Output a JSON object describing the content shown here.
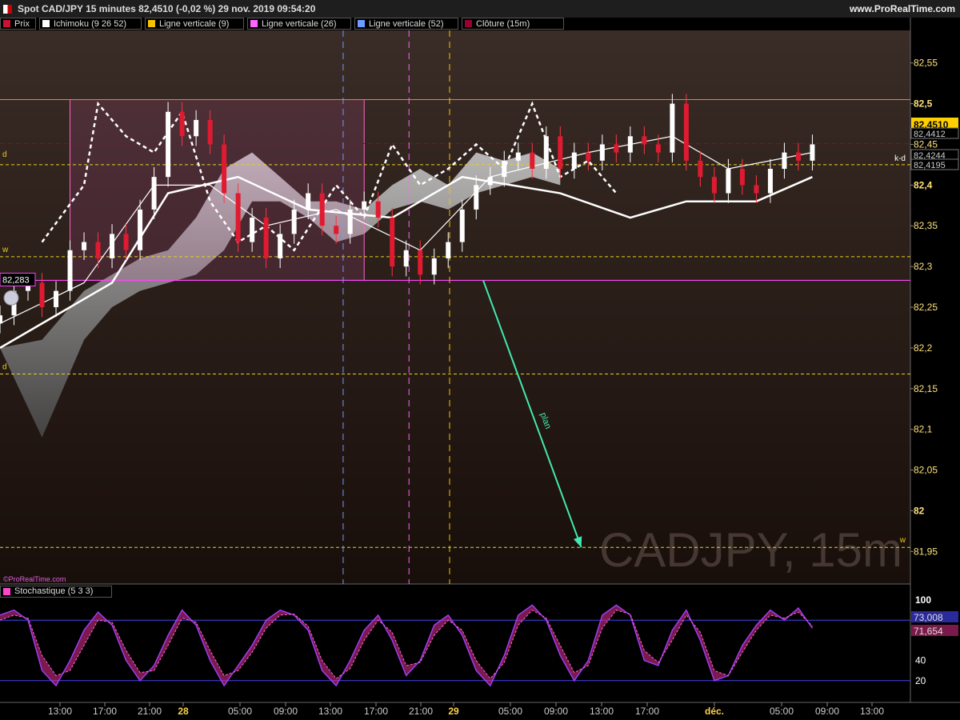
{
  "header": {
    "title": "Spot CAD/JPY 15 minutes 82,4510 (-0,02 %) 29 nov. 2019 09:54:20",
    "site": "www.ProRealTime.com"
  },
  "legend": [
    {
      "label": "Prix",
      "color": "#cc1133",
      "icon": "price-swatch"
    },
    {
      "label": "Ichimoku (9 26 52)",
      "color": "#ffffff",
      "icon": "ichimoku-swatch"
    },
    {
      "label": "Ligne verticale (9)",
      "color": "#f5c400",
      "icon": "vertical-line-swatch"
    },
    {
      "label": "Ligne verticale (26)",
      "color": "#ff66ff",
      "icon": "vertical-line-swatch"
    },
    {
      "label": "Ligne verticale (52)",
      "color": "#6f9cff",
      "icon": "vertical-line-swatch"
    },
    {
      "label": "Clôture (15m)",
      "color": "#990033",
      "icon": "close-swatch"
    }
  ],
  "stoch_legend": {
    "label": "Stochastique (5 3 3)",
    "color": "#ff44cc"
  },
  "copyright": "©ProRealTime.com",
  "watermark": "CADJPY, 15m",
  "current_price_label": "82,4510",
  "left_price_label": "82,283",
  "arrow_label": "plan",
  "level_markers": {
    "d_upper": "d",
    "w_upper": "w",
    "d_lower": "d",
    "w_lower": "w",
    "kd": "k-d"
  },
  "right_value_labels": [
    "82,4510",
    "82,4412",
    "82,4244",
    "82,4195"
  ],
  "stoch_value_labels": [
    "73,008",
    "71,654"
  ],
  "colors": {
    "background": "#000000",
    "price_panel_top": "#3a2c26",
    "price_panel_bottom": "#180e0a",
    "box_border": "#ff66cc",
    "arrow": "#44e8b0",
    "level_line": "#e8d020",
    "resistance": "#ff7733"
  },
  "chart_data": [
    {
      "type": "line",
      "title": "Spot CAD/JPY 15 minutes",
      "ylim": [
        81.91,
        82.59
      ],
      "y_ticks": [
        "82,55",
        "82,5",
        "82,45",
        "82,4",
        "82,35",
        "82,3",
        "82,25",
        "82,2",
        "82,15",
        "82,1",
        "82,05",
        "82",
        "81,95"
      ],
      "y_tick_values": [
        82.55,
        82.5,
        82.45,
        82.4,
        82.35,
        82.3,
        82.25,
        82.2,
        82.15,
        82.1,
        82.05,
        82.0,
        81.95
      ],
      "x_ticks": [
        "13:00",
        "17:00",
        "21:00",
        "28",
        "05:00",
        "09:00",
        "13:00",
        "17:00",
        "21:00",
        "29",
        "05:00",
        "09:00",
        "13:00",
        "17:00",
        "déc.",
        "05:00",
        "09:00",
        "13:00"
      ],
      "horizontal_levels": [
        {
          "name": "d upper",
          "value": 82.425
        },
        {
          "name": "w upper",
          "value": 82.312
        },
        {
          "name": "d lower",
          "value": 82.168
        },
        {
          "name": "w lower",
          "value": 81.955
        },
        {
          "name": "resistance",
          "value": 82.505
        },
        {
          "name": "support",
          "value": 82.283
        },
        {
          "name": "last close",
          "value": 82.451
        }
      ],
      "price_series": [
        {
          "t": 0,
          "v": 82.24
        },
        {
          "t": 1,
          "v": 82.27
        },
        {
          "t": 2,
          "v": 82.28
        },
        {
          "t": 3,
          "v": 82.25
        },
        {
          "t": 4,
          "v": 82.27
        },
        {
          "t": 5,
          "v": 82.32
        },
        {
          "t": 6,
          "v": 82.33
        },
        {
          "t": 7,
          "v": 82.31
        },
        {
          "t": 8,
          "v": 82.34
        },
        {
          "t": 9,
          "v": 82.32
        },
        {
          "t": 10,
          "v": 82.37
        },
        {
          "t": 11,
          "v": 82.41
        },
        {
          "t": 12,
          "v": 82.49
        },
        {
          "t": 13,
          "v": 82.46
        },
        {
          "t": 14,
          "v": 82.48
        },
        {
          "t": 15,
          "v": 82.45
        },
        {
          "t": 16,
          "v": 82.39
        },
        {
          "t": 17,
          "v": 82.33
        },
        {
          "t": 18,
          "v": 82.36
        },
        {
          "t": 19,
          "v": 82.31
        },
        {
          "t": 20,
          "v": 82.34
        },
        {
          "t": 21,
          "v": 82.37
        },
        {
          "t": 22,
          "v": 82.39
        },
        {
          "t": 23,
          "v": 82.35
        },
        {
          "t": 24,
          "v": 82.34
        },
        {
          "t": 25,
          "v": 82.37
        },
        {
          "t": 26,
          "v": 82.38
        },
        {
          "t": 27,
          "v": 82.36
        },
        {
          "t": 28,
          "v": 82.3
        },
        {
          "t": 29,
          "v": 82.32
        },
        {
          "t": 30,
          "v": 82.29
        },
        {
          "t": 31,
          "v": 82.31
        },
        {
          "t": 32,
          "v": 82.33
        },
        {
          "t": 33,
          "v": 82.37
        },
        {
          "t": 34,
          "v": 82.4
        },
        {
          "t": 35,
          "v": 82.41
        },
        {
          "t": 36,
          "v": 82.43
        },
        {
          "t": 37,
          "v": 82.44
        },
        {
          "t": 38,
          "v": 82.42
        },
        {
          "t": 39,
          "v": 82.46
        },
        {
          "t": 40,
          "v": 82.42
        },
        {
          "t": 41,
          "v": 82.44
        },
        {
          "t": 42,
          "v": 82.43
        },
        {
          "t": 43,
          "v": 82.45
        },
        {
          "t": 44,
          "v": 82.44
        },
        {
          "t": 45,
          "v": 82.46
        },
        {
          "t": 46,
          "v": 82.45
        },
        {
          "t": 47,
          "v": 82.44
        },
        {
          "t": 48,
          "v": 82.5
        },
        {
          "t": 49,
          "v": 82.43
        },
        {
          "t": 50,
          "v": 82.41
        },
        {
          "t": 51,
          "v": 82.39
        },
        {
          "t": 52,
          "v": 82.42
        },
        {
          "t": 53,
          "v": 82.4
        },
        {
          "t": 54,
          "v": 82.39
        },
        {
          "t": 55,
          "v": 82.42
        },
        {
          "t": 56,
          "v": 82.44
        },
        {
          "t": 57,
          "v": 82.43
        },
        {
          "t": 58,
          "v": 82.45
        }
      ],
      "ichimoku_lines": [
        {
          "name": "tenkan",
          "points": [
            [
              0,
              82.23
            ],
            [
              6,
              82.28
            ],
            [
              11,
              82.4
            ],
            [
              15,
              82.4
            ],
            [
              19,
              82.35
            ],
            [
              24,
              82.37
            ],
            [
              30,
              82.32
            ],
            [
              35,
              82.41
            ],
            [
              42,
              82.44
            ],
            [
              48,
              82.46
            ],
            [
              52,
              82.42
            ],
            [
              58,
              82.44
            ]
          ]
        },
        {
          "name": "kijun",
          "points": [
            [
              0,
              82.2
            ],
            [
              5,
              82.25
            ],
            [
              8,
              82.28
            ],
            [
              12,
              82.39
            ],
            [
              17,
              82.41
            ],
            [
              22,
              82.37
            ],
            [
              28,
              82.36
            ],
            [
              33,
              82.41
            ],
            [
              40,
              82.39
            ],
            [
              45,
              82.36
            ],
            [
              49,
              82.38
            ],
            [
              54,
              82.38
            ],
            [
              58,
              82.41
            ]
          ]
        },
        {
          "name": "chikou",
          "points": [
            [
              3,
              82.33
            ],
            [
              6,
              82.4
            ],
            [
              7,
              82.5
            ],
            [
              9,
              82.46
            ],
            [
              11,
              82.44
            ],
            [
              13,
              82.49
            ],
            [
              15,
              82.38
            ],
            [
              17,
              82.33
            ],
            [
              19,
              82.35
            ],
            [
              21,
              82.32
            ],
            [
              24,
              82.4
            ],
            [
              26,
              82.36
            ],
            [
              28,
              82.45
            ],
            [
              30,
              82.4
            ],
            [
              32,
              82.42
            ],
            [
              34,
              82.45
            ],
            [
              36,
              82.42
            ],
            [
              38,
              82.5
            ],
            [
              40,
              82.41
            ],
            [
              42,
              82.43
            ],
            [
              44,
              82.39
            ]
          ]
        }
      ],
      "cloud": [
        [
          0,
          82.2,
          82.2
        ],
        [
          3,
          82.09,
          82.21
        ],
        [
          6,
          82.21,
          82.27
        ],
        [
          8,
          82.25,
          82.29
        ],
        [
          10,
          82.27,
          82.31
        ],
        [
          12,
          82.28,
          82.32
        ],
        [
          14,
          82.29,
          82.36
        ],
        [
          16,
          82.32,
          82.42
        ],
        [
          18,
          82.38,
          82.44
        ],
        [
          20,
          82.38,
          82.41
        ],
        [
          22,
          82.36,
          82.38
        ],
        [
          24,
          82.33,
          82.38
        ],
        [
          26,
          82.34,
          82.37
        ],
        [
          28,
          82.37,
          82.4
        ],
        [
          30,
          82.38,
          82.42
        ],
        [
          32,
          82.37,
          82.4
        ],
        [
          34,
          82.39,
          82.44
        ],
        [
          36,
          82.4,
          82.43
        ],
        [
          38,
          82.41,
          82.44
        ],
        [
          40,
          82.4,
          82.42
        ]
      ],
      "box": {
        "t_start": 5,
        "t_end": 26,
        "v_low": 82.283,
        "v_high": 82.505
      },
      "vertical_lines": [
        {
          "name": "Ligne verticale (52)",
          "t": 24.5
        },
        {
          "name": "Ligne verticale (26)",
          "t": 29.2
        },
        {
          "name": "Ligne verticale (9)",
          "t": 32.1
        }
      ],
      "projection_arrow": {
        "from": [
          34.5,
          82.283
        ],
        "to": [
          41.5,
          81.955
        ],
        "label": "plan"
      }
    },
    {
      "type": "line",
      "title": "Stochastique (5 3 3)",
      "ylim": [
        0,
        100
      ],
      "y_ticks": [
        "100",
        "40",
        "20"
      ],
      "y_tick_values": [
        100,
        40,
        20
      ],
      "levels": [
        80,
        20
      ],
      "series": [
        {
          "name": "%K",
          "values": [
            85,
            90,
            80,
            30,
            15,
            40,
            70,
            88,
            75,
            40,
            20,
            35,
            65,
            90,
            75,
            40,
            15,
            35,
            55,
            80,
            90,
            85,
            70,
            30,
            15,
            40,
            70,
            85,
            60,
            25,
            40,
            75,
            85,
            65,
            30,
            15,
            45,
            85,
            95,
            80,
            45,
            20,
            40,
            85,
            95,
            85,
            40,
            35,
            70,
            90,
            60,
            20,
            25,
            55,
            75,
            90,
            80,
            92,
            72
          ]
        },
        {
          "name": "%D",
          "values": [
            80,
            85,
            82,
            45,
            25,
            30,
            55,
            80,
            78,
            50,
            28,
            30,
            55,
            82,
            78,
            50,
            25,
            30,
            48,
            72,
            85,
            86,
            74,
            40,
            22,
            32,
            60,
            80,
            68,
            35,
            38,
            65,
            80,
            70,
            40,
            22,
            38,
            75,
            90,
            82,
            55,
            28,
            35,
            72,
            90,
            86,
            50,
            38,
            60,
            85,
            68,
            30,
            25,
            48,
            70,
            85,
            82,
            88,
            74
          ]
        }
      ]
    }
  ]
}
